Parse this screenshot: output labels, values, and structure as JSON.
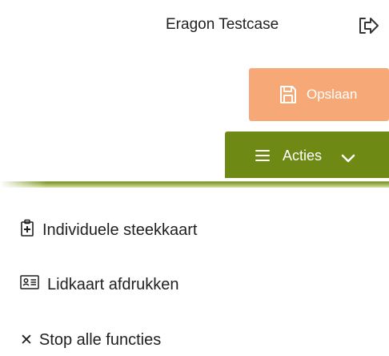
{
  "header": {
    "user_name": "Eragon Testcase",
    "logout_icon": "logout-icon"
  },
  "toolbar": {
    "save_label": "Opslaan",
    "save_icon": "floppy-disk-icon",
    "actions_label": "Acties",
    "actions_icon": "hamburger-icon",
    "actions_chevron": "chevron-down-icon"
  },
  "colors": {
    "save_button": "#f7a877",
    "actions_button": "#6e8a15"
  },
  "menu": {
    "items": [
      {
        "label": "Individuele steekkaart",
        "icon": "clipboard-plus-icon"
      },
      {
        "label": "Lidkaart afdrukken",
        "icon": "id-card-icon"
      },
      {
        "label": "Stop alle functies",
        "icon": "close-icon"
      }
    ]
  }
}
